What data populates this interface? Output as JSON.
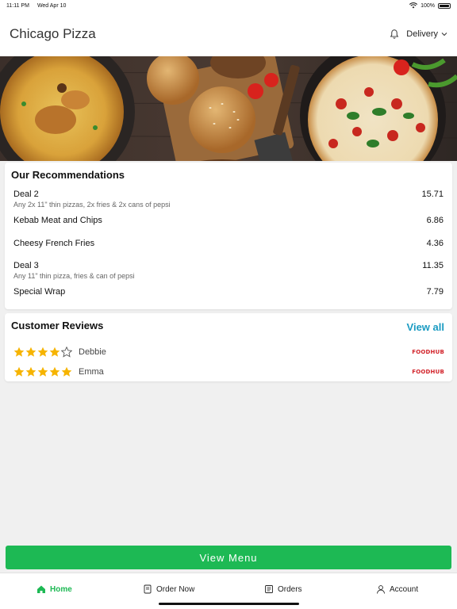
{
  "status": {
    "time": "11:11 PM",
    "date": "Wed Apr 10",
    "battery": "100%",
    "battery_level": 1.0
  },
  "header": {
    "title": "Chicago Pizza",
    "delivery_label": "Delivery"
  },
  "recommendations": {
    "title": "Our Recommendations",
    "items": [
      {
        "name": "Deal 2",
        "desc": "Any 2x 11\" thin pizzas, 2x fries & 2x cans of pepsi",
        "price": "15.71"
      },
      {
        "name": "Kebab Meat and Chips",
        "desc": "",
        "price": "6.86"
      },
      {
        "name": "Cheesy French Fries",
        "desc": "",
        "price": "4.36"
      },
      {
        "name": "Deal 3",
        "desc": "Any 11\" thin pizza, fries & can of pepsi",
        "price": "11.35"
      },
      {
        "name": "Special Wrap",
        "desc": "",
        "price": "7.79"
      }
    ]
  },
  "reviews": {
    "title": "Customer Reviews",
    "view_all_label": "View all",
    "items": [
      {
        "name": "Debbie",
        "rating": 4,
        "max_rating": 5,
        "source": "FOODHUB"
      },
      {
        "name": "Emma",
        "rating": 5,
        "max_rating": 5,
        "source": "FOODHUB"
      }
    ]
  },
  "view_menu_label": "View Menu",
  "nav": {
    "home": "Home",
    "order_now": "Order Now",
    "orders": "Orders",
    "account": "Account"
  },
  "colors": {
    "accent": "#1db954",
    "link": "#1a9bc2",
    "star": "#f6b400",
    "brand_logo": "#d2232a"
  }
}
